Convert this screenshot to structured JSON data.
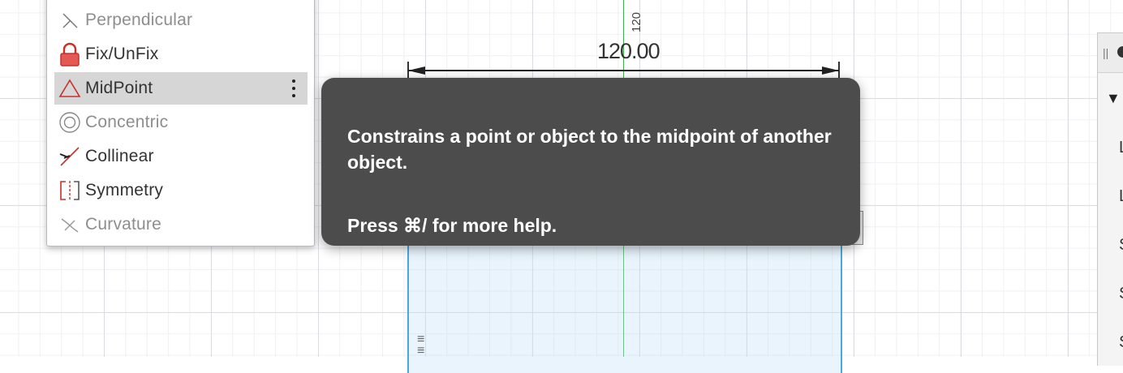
{
  "menu": {
    "items": [
      {
        "label": "Perpendicular",
        "icon": "perpendicular-icon",
        "state": "disabled"
      },
      {
        "label": "Fix/UnFix",
        "icon": "lock-icon",
        "state": "enabled"
      },
      {
        "label": "MidPoint",
        "icon": "triangle-icon",
        "state": "selected"
      },
      {
        "label": "Concentric",
        "icon": "concentric-icon",
        "state": "disabled"
      },
      {
        "label": "Collinear",
        "icon": "collinear-icon",
        "state": "enabled"
      },
      {
        "label": "Symmetry",
        "icon": "symmetry-icon",
        "state": "enabled"
      },
      {
        "label": "Curvature",
        "icon": "curvature-icon",
        "state": "disabled"
      }
    ]
  },
  "tooltip": {
    "description": "Constrains a point or object to the midpoint of another object.",
    "help": "Press ⌘/ for more help."
  },
  "canvas": {
    "dimension_value": "120.00",
    "rotated_label": "120"
  },
  "right_panel": {
    "letters": [
      "L",
      "L",
      "S",
      "S",
      "S"
    ]
  },
  "colors": {
    "tooltip_bg": "#4c4c4c",
    "selected_row": "#d6d6d6",
    "icon_red": "#c9302c",
    "axis_green": "#3fb34f",
    "sketch_blue": "#4aa8e0"
  }
}
